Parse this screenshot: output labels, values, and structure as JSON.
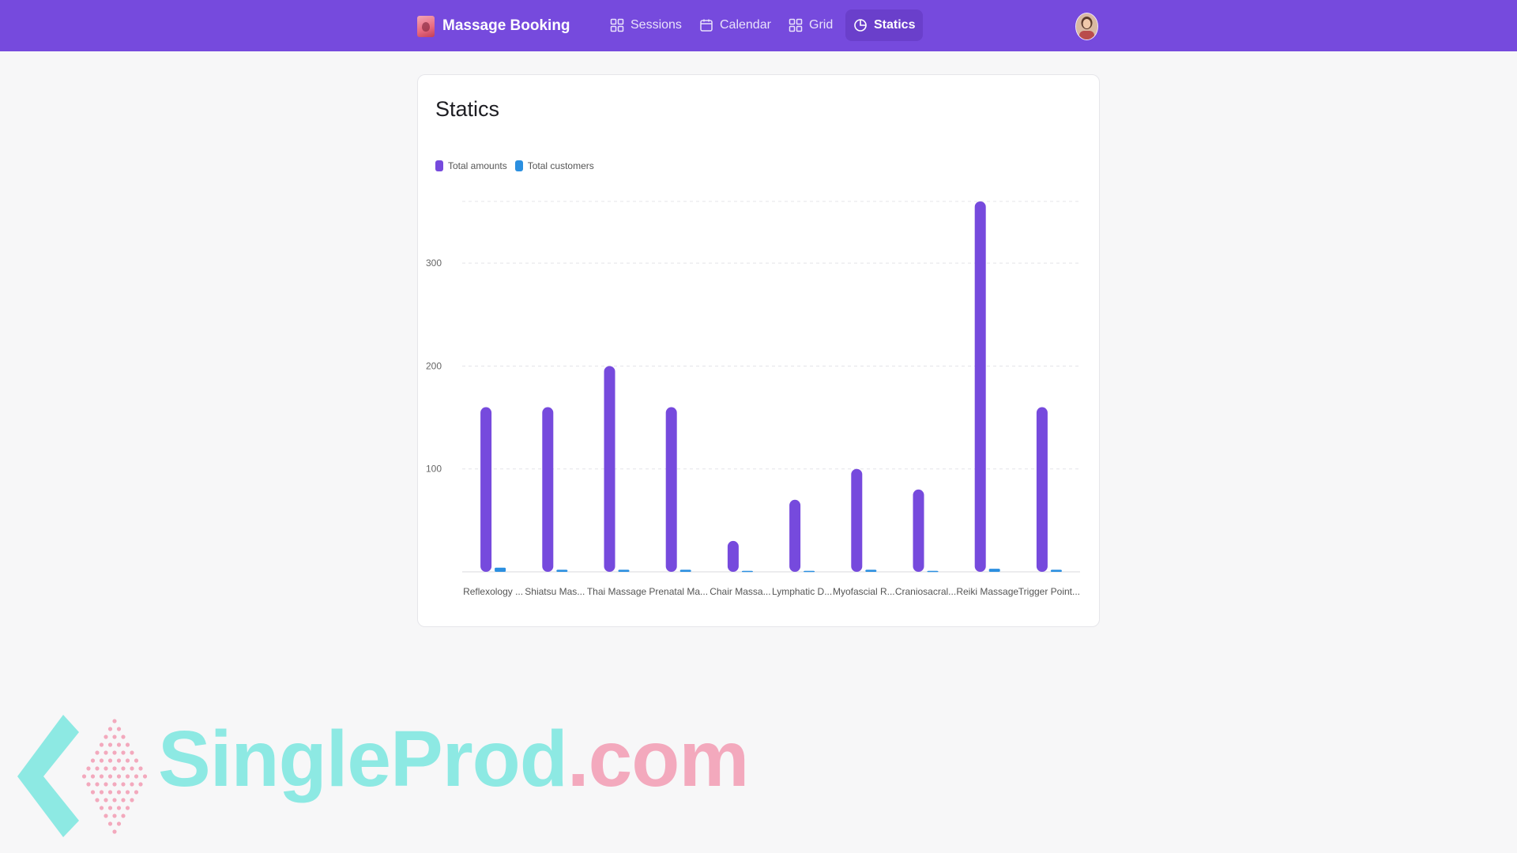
{
  "app": {
    "title": "Massage Booking",
    "accent_color": "#764add"
  },
  "nav": {
    "items": [
      {
        "label": "Sessions",
        "icon": "grid-icon",
        "active": false
      },
      {
        "label": "Calendar",
        "icon": "calendar-icon",
        "active": false
      },
      {
        "label": "Grid",
        "icon": "grid-icon",
        "active": false
      },
      {
        "label": "Statics",
        "icon": "pie-chart-icon",
        "active": true
      }
    ]
  },
  "user": {
    "avatar_icon": "user-avatar"
  },
  "page": {
    "title": "Statics"
  },
  "legend": {
    "total_amounts": "Total amounts",
    "total_customers": "Total customers"
  },
  "chart_data": {
    "type": "bar",
    "categories": [
      "Reflexology ...",
      "Shiatsu Mas...",
      "Thai Massage",
      "Prenatal Ma...",
      "Chair Massa...",
      "Lymphatic D...",
      "Myofascial R...",
      "Craniosacral...",
      "Reiki Massage",
      "Trigger Point..."
    ],
    "series": [
      {
        "name": "Total amounts",
        "color": "#764add",
        "values": [
          160,
          160,
          200,
          160,
          30,
          70,
          100,
          80,
          360,
          160
        ]
      },
      {
        "name": "Total customers",
        "color": "#2b8fe0",
        "values": [
          4,
          2,
          2,
          2,
          1,
          1,
          2,
          1,
          3,
          2
        ]
      }
    ],
    "yticks": [
      100,
      200,
      300
    ],
    "ylim": [
      0,
      360
    ],
    "grid": true,
    "legend_position": "top-left"
  },
  "watermark": {
    "part1": "SingleProd",
    "part2": ".com"
  }
}
